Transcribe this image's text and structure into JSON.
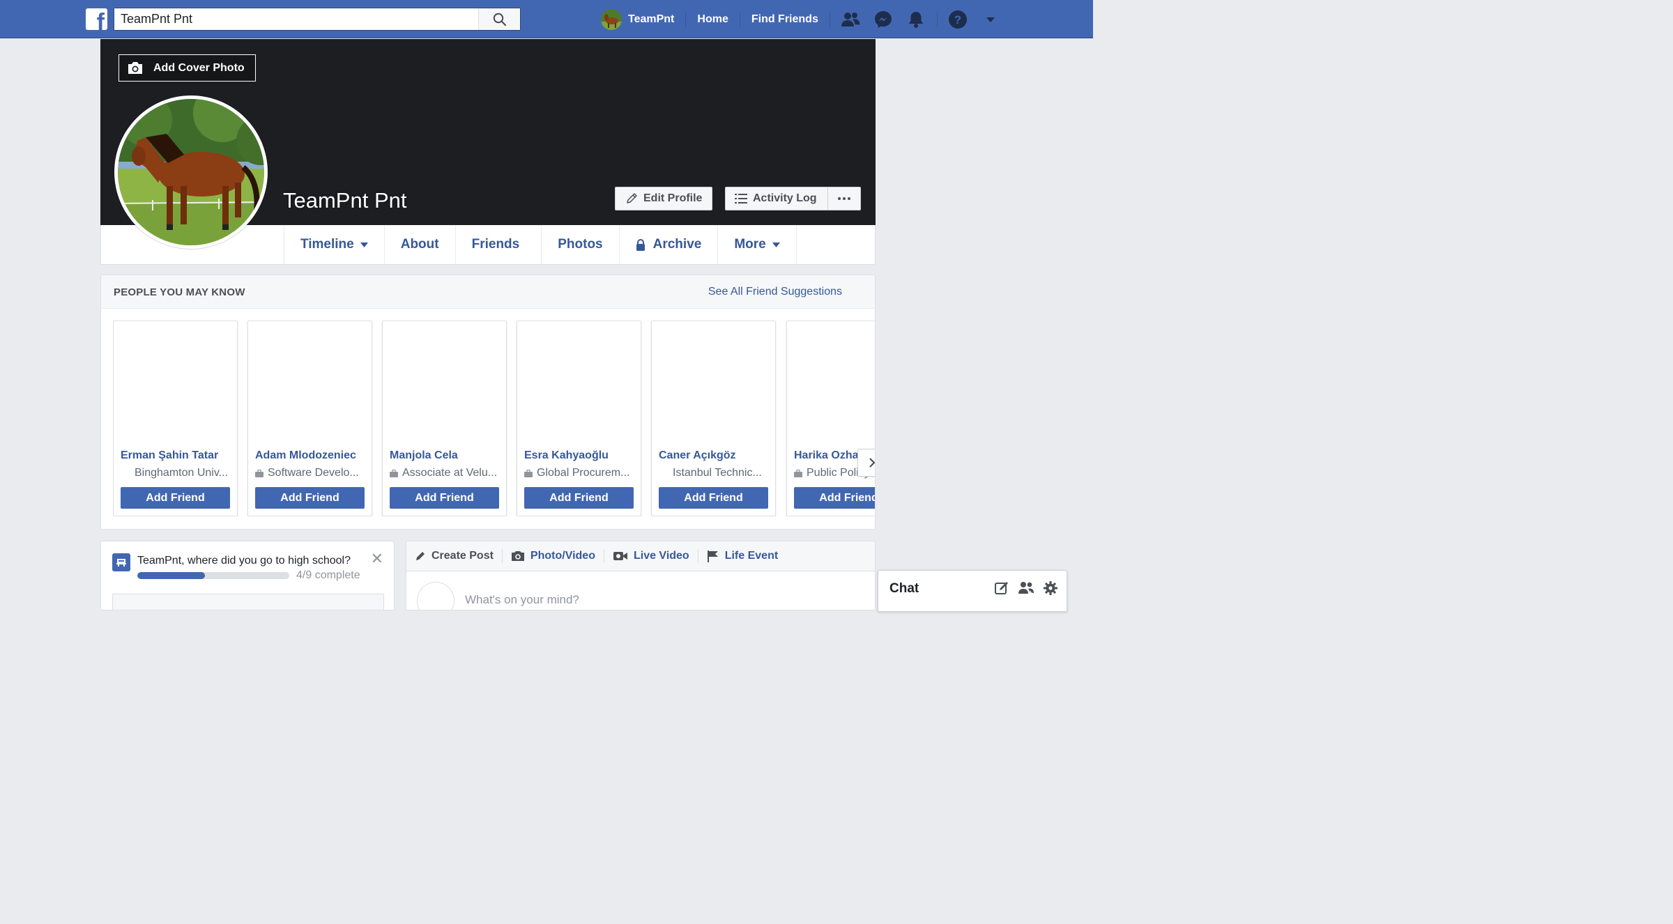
{
  "topbar": {
    "logo": "f",
    "search": {
      "value": "TeamPnt Pnt",
      "placeholder": "Search"
    },
    "user_name": "TeamPnt",
    "home": "Home",
    "find_friends": "Find Friends",
    "icons": [
      "friend-requests-icon",
      "messenger-icon",
      "notifications-icon",
      "help-icon",
      "account-menu-icon"
    ]
  },
  "profile": {
    "add_cover_label": "Add Cover Photo",
    "name": "TeamPnt Pnt",
    "edit_profile_label": "Edit Profile",
    "activity_log_label": "Activity Log",
    "tabs": [
      {
        "label": "Timeline"
      },
      {
        "label": "About"
      },
      {
        "label": "Friends"
      },
      {
        "label": "Photos"
      },
      {
        "label": "Archive"
      },
      {
        "label": "More"
      }
    ]
  },
  "pymk": {
    "title": "PEOPLE YOU MAY KNOW",
    "see_all": "See All Friend Suggestions",
    "add_label": "Add Friend",
    "people": [
      {
        "name": "Erman Şahin Tatar",
        "sub": "Binghamton Univ...",
        "sub_icon": "none"
      },
      {
        "name": "Adam Mlodozeniec",
        "sub": "Software Develo...",
        "sub_icon": "briefcase-icon"
      },
      {
        "name": "Manjola Cela",
        "sub": "Associate at Velu...",
        "sub_icon": "briefcase-icon"
      },
      {
        "name": "Esra Kahyaoğlu",
        "sub": "Global Procurem...",
        "sub_icon": "briefcase-icon"
      },
      {
        "name": "Caner Açıkgöz",
        "sub": "Istanbul Technic...",
        "sub_icon": "none"
      },
      {
        "name": "Harika Ozhalep",
        "sub": "Public Policy",
        "sub_icon": "briefcase-icon"
      }
    ]
  },
  "high_school": {
    "question": "TeamPnt, where did you go to high school?",
    "progress_text": "4/9 complete",
    "progress_fraction": 0.444
  },
  "composer": {
    "tabs": [
      "Create Post",
      "Photo/Video",
      "Live Video",
      "Life Event"
    ],
    "placeholder": "What's on your mind?"
  },
  "chat": {
    "label": "Chat"
  },
  "colors": {
    "brand": "#4267b2",
    "link": "#365899",
    "page_bg": "#e9ebee",
    "cover_bg": "#1c1e21"
  }
}
